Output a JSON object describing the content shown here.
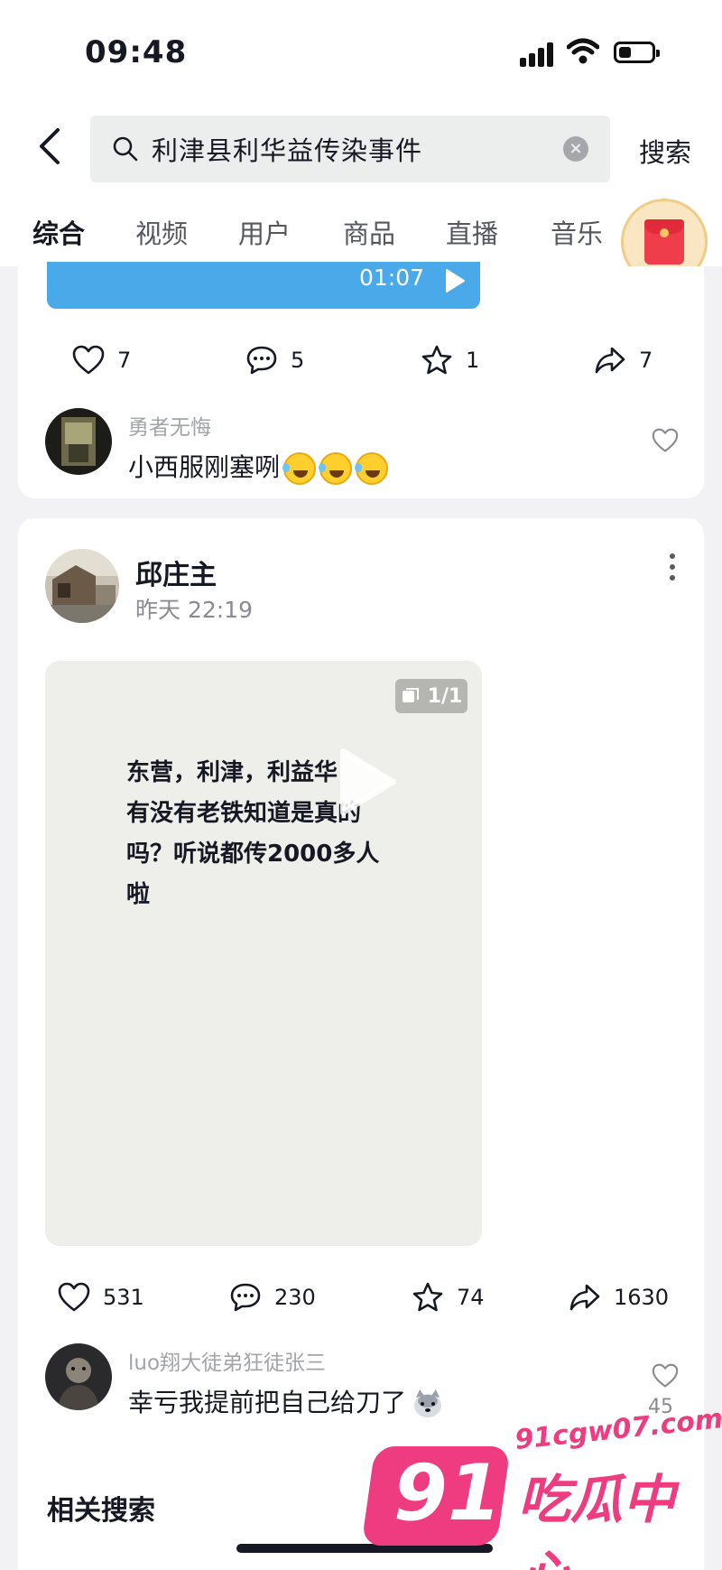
{
  "status_bar": {
    "time": "09:48"
  },
  "search": {
    "query": "利津县利华益传染事件",
    "button_label": "搜索"
  },
  "tabs": [
    {
      "label": "综合",
      "active": true
    },
    {
      "label": "视频"
    },
    {
      "label": "用户"
    },
    {
      "label": "商品"
    },
    {
      "label": "直播"
    },
    {
      "label": "音乐"
    }
  ],
  "post1": {
    "video_duration": "01:07",
    "likes": "7",
    "comments": "5",
    "favorites": "1",
    "shares": "7",
    "top_comment": {
      "author": "勇者无悔",
      "text": "小西服刚塞咧"
    }
  },
  "post2": {
    "author": "邱庄主",
    "time": "昨天 22:19",
    "page_indicator": "1/1",
    "media_text": [
      "东营，利津，利益华",
      "有没有老铁知道是真的",
      "吗？听说都传2000多人",
      "啦"
    ],
    "likes": "531",
    "comments": "230",
    "favorites": "74",
    "shares": "1630",
    "top_comment": {
      "author": "luo翔大徒弟狂徒张三",
      "text": "幸亏我提前把自己给刀了",
      "likes": "45"
    }
  },
  "related": {
    "title": "相关搜索"
  },
  "watermark": {
    "number": "91",
    "url": "91cgw07.com",
    "name": "吃瓜中心"
  },
  "colors": {
    "accent_blue": "#4aa9e9",
    "watermark_pink": "#ef3b7f",
    "red_packet": "#f03d4c"
  }
}
